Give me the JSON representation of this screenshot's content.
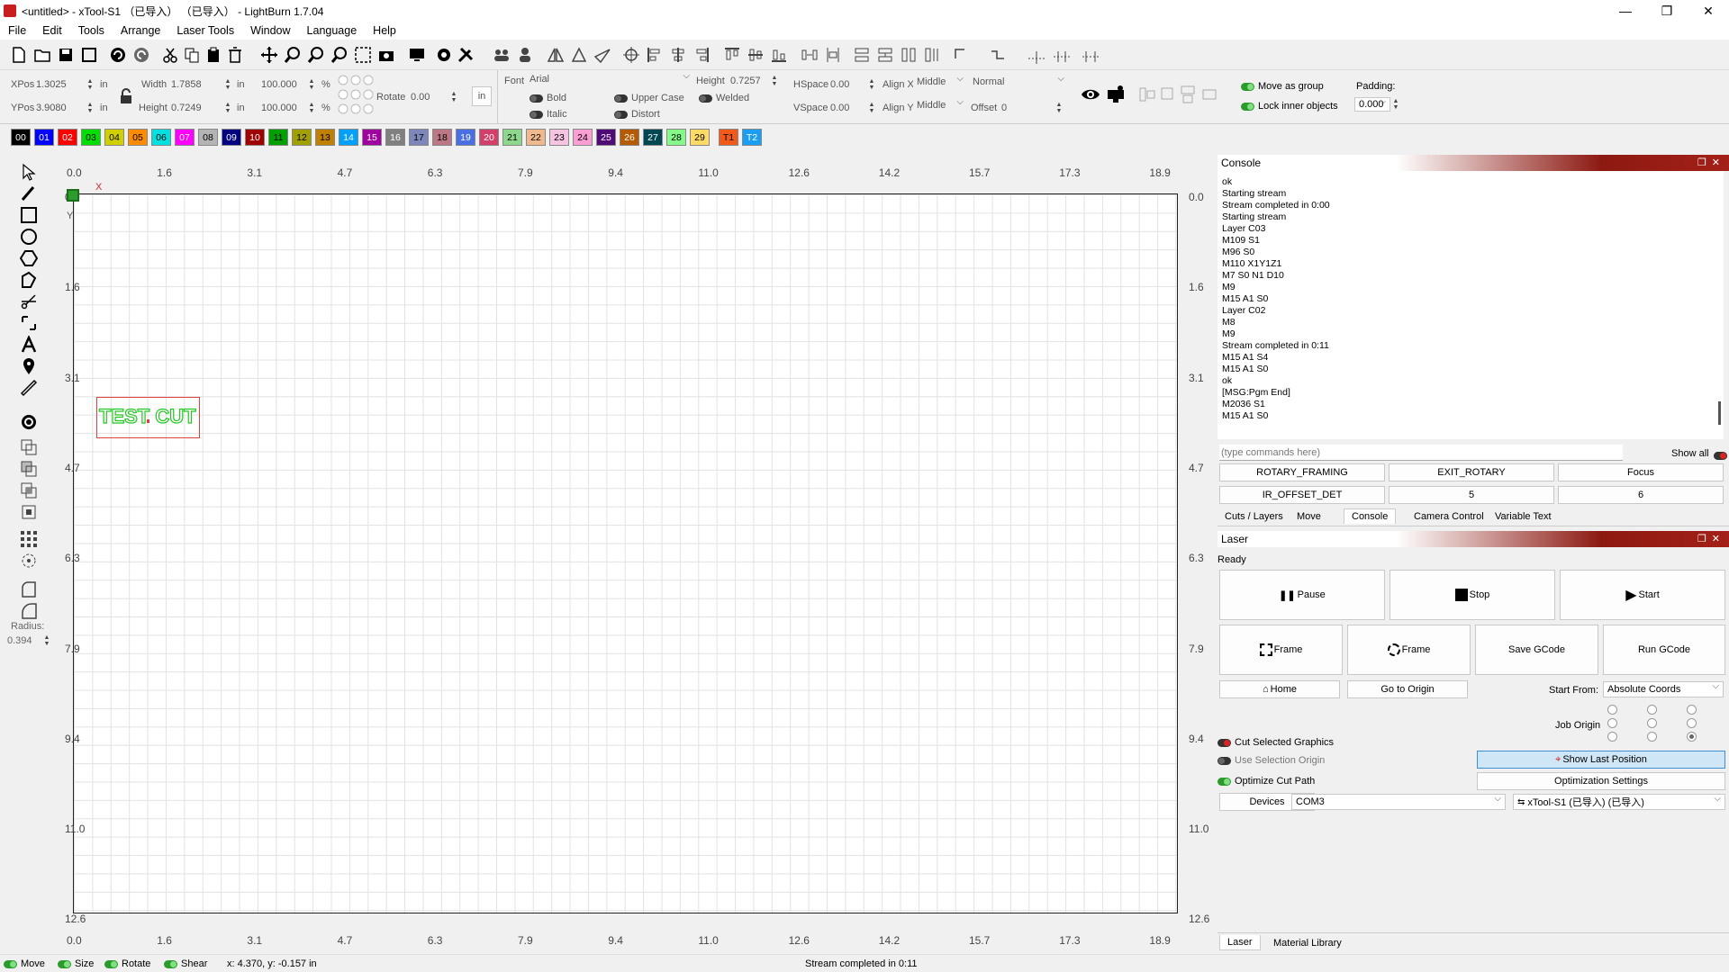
{
  "window": {
    "title": "<untitled> - xTool-S1 （已导入） （已导入） - LightBurn 1.7.04"
  },
  "menu": [
    "File",
    "Edit",
    "Tools",
    "Arrange",
    "Laser Tools",
    "Window",
    "Language",
    "Help"
  ],
  "props": {
    "xpos_label": "XPos",
    "xpos": "1.3025",
    "ypos_label": "YPos",
    "ypos": "3.9080",
    "unit": "in",
    "width_label": "Width",
    "width": "1.7858",
    "height_label": "Height",
    "height": "0.7249",
    "wpct": "100.000",
    "hpct": "100.000",
    "pct": "%",
    "rotate_label": "Rotate",
    "rotate": "0.00",
    "in_button": "in",
    "font_label": "Font",
    "font": "Arial",
    "fheight_label": "Height",
    "fheight": "0.7257",
    "hspace_label": "HSpace",
    "hspace": "0.00",
    "vspace_label": "VSpace",
    "vspace": "0.00",
    "alignx_label": "Align X",
    "alignx": "Middle",
    "aligny_label": "Align Y",
    "aligny": "Middle",
    "normal": "Normal",
    "offset_label": "Offset",
    "offset": "0",
    "bold": "Bold",
    "italic": "Italic",
    "upper": "Upper Case",
    "distort": "Distort",
    "welded": "Welded",
    "move_group": "Move as group",
    "lock_inner": "Lock inner objects",
    "padding_label": "Padding:",
    "padding": "0.000"
  },
  "layers": [
    {
      "l": "00",
      "c": "#000000",
      "t": "#ffffff"
    },
    {
      "l": "01",
      "c": "#0000ff",
      "t": "#ffffff"
    },
    {
      "l": "02",
      "c": "#ff0000",
      "t": "#ffffff"
    },
    {
      "l": "03",
      "c": "#00e000",
      "t": "#000000"
    },
    {
      "l": "04",
      "c": "#d0d000",
      "t": "#000000"
    },
    {
      "l": "05",
      "c": "#ff8c00",
      "t": "#000000"
    },
    {
      "l": "06",
      "c": "#00e0e0",
      "t": "#000000"
    },
    {
      "l": "07",
      "c": "#ff00ff",
      "t": "#ffffff"
    },
    {
      "l": "08",
      "c": "#b4b4b4",
      "t": "#000000"
    },
    {
      "l": "09",
      "c": "#000080",
      "t": "#ffffff"
    },
    {
      "l": "10",
      "c": "#a00000",
      "t": "#ffffff"
    },
    {
      "l": "11",
      "c": "#00a000",
      "t": "#000000"
    },
    {
      "l": "12",
      "c": "#a0a000",
      "t": "#000000"
    },
    {
      "l": "13",
      "c": "#c08000",
      "t": "#000000"
    },
    {
      "l": "14",
      "c": "#00a0ff",
      "t": "#ffffff"
    },
    {
      "l": "15",
      "c": "#a000a0",
      "t": "#ffffff"
    },
    {
      "l": "16",
      "c": "#808080",
      "t": "#ffffff"
    },
    {
      "l": "17",
      "c": "#7d87b9",
      "t": "#000000"
    },
    {
      "l": "18",
      "c": "#bb7784",
      "t": "#000000"
    },
    {
      "l": "19",
      "c": "#4a6fe3",
      "t": "#ffffff"
    },
    {
      "l": "20",
      "c": "#d33f6a",
      "t": "#ffffff"
    },
    {
      "l": "21",
      "c": "#8cd78c",
      "t": "#000000"
    },
    {
      "l": "22",
      "c": "#f0b98d",
      "t": "#000000"
    },
    {
      "l": "23",
      "c": "#f6c4e1",
      "t": "#000000"
    },
    {
      "l": "24",
      "c": "#fa9ed4",
      "t": "#000000"
    },
    {
      "l": "25",
      "c": "#500a78",
      "t": "#ffffff"
    },
    {
      "l": "26",
      "c": "#b45a00",
      "t": "#ffffff"
    },
    {
      "l": "27",
      "c": "#004754",
      "t": "#ffffff"
    },
    {
      "l": "28",
      "c": "#86fa88",
      "t": "#000000"
    },
    {
      "l": "29",
      "c": "#ffdb66",
      "t": "#000000"
    },
    {
      "l": "T1",
      "c": "#f35a1a",
      "t": "#000000"
    },
    {
      "l": "T2",
      "c": "#1a9ef3",
      "t": "#ffffff"
    }
  ],
  "ruler": {
    "x": [
      "0.0",
      "1.6",
      "3.1",
      "4.7",
      "6.3",
      "7.9",
      "9.4",
      "11.0",
      "12.6",
      "14.2",
      "15.7",
      "17.3",
      "18.9"
    ],
    "y": [
      "0.0",
      "1.6",
      "3.1",
      "4.7",
      "6.3",
      "7.9",
      "9.4",
      "11.0",
      "12.6"
    ],
    "x_axis": "X",
    "y_axis": "Y"
  },
  "canvas": {
    "text": "TEST CUT",
    "radius_label": "Radius:",
    "radius": "0.394"
  },
  "console": {
    "title": "Console",
    "lines": [
      "ok",
      "Starting stream",
      "Stream completed in 0:00",
      "Starting stream",
      "Layer C03",
      "M109 S1",
      "M96 S0",
      "M110 X1Y1Z1",
      "M7 S0 N1 D10",
      "M9",
      "M15 A1 S0",
      "Layer C02",
      "M8",
      "M9",
      "Stream completed in 0:11",
      "M15 A1 S4",
      "M15 A1 S0",
      "ok",
      "[MSG:Pgm End]",
      "M2036 S1",
      "M15 A1 S0"
    ],
    "input_placeholder": "(type commands here)",
    "show_all": "Show all",
    "macros": [
      "ROTARY_FRAMING",
      "EXIT_ROTARY",
      "Focus",
      "IR_OFFSET_DET",
      "5",
      "6"
    ],
    "tabs": [
      "Cuts / Layers",
      "Move",
      "Console",
      "Camera Control",
      "Variable Text"
    ]
  },
  "laser": {
    "title": "Laser",
    "status": "Ready",
    "pause": "Pause",
    "stop": "Stop",
    "start": "Start",
    "frame1": "Frame",
    "frame2": "Frame",
    "save_gcode": "Save GCode",
    "run_gcode": "Run GCode",
    "home": "Home",
    "goto_origin": "Go to Origin",
    "start_from_label": "Start From:",
    "start_from": "Absolute Coords",
    "job_origin": "Job Origin",
    "cut_selected": "Cut Selected Graphics",
    "use_sel_origin": "Use Selection Origin",
    "optimize": "Optimize Cut Path",
    "show_last": "Show Last Position",
    "opt_settings": "Optimization Settings",
    "devices": "Devices",
    "port": "COM3",
    "device": "xTool-S1 (已导入) (已导入)",
    "tabs": [
      "Laser",
      "Material Library"
    ]
  },
  "status": {
    "move": "Move",
    "size": "Size",
    "rotate": "Rotate",
    "shear": "Shear",
    "coords": "x: 4.370, y: -0.157 in",
    "message": "Stream completed in 0:11"
  }
}
